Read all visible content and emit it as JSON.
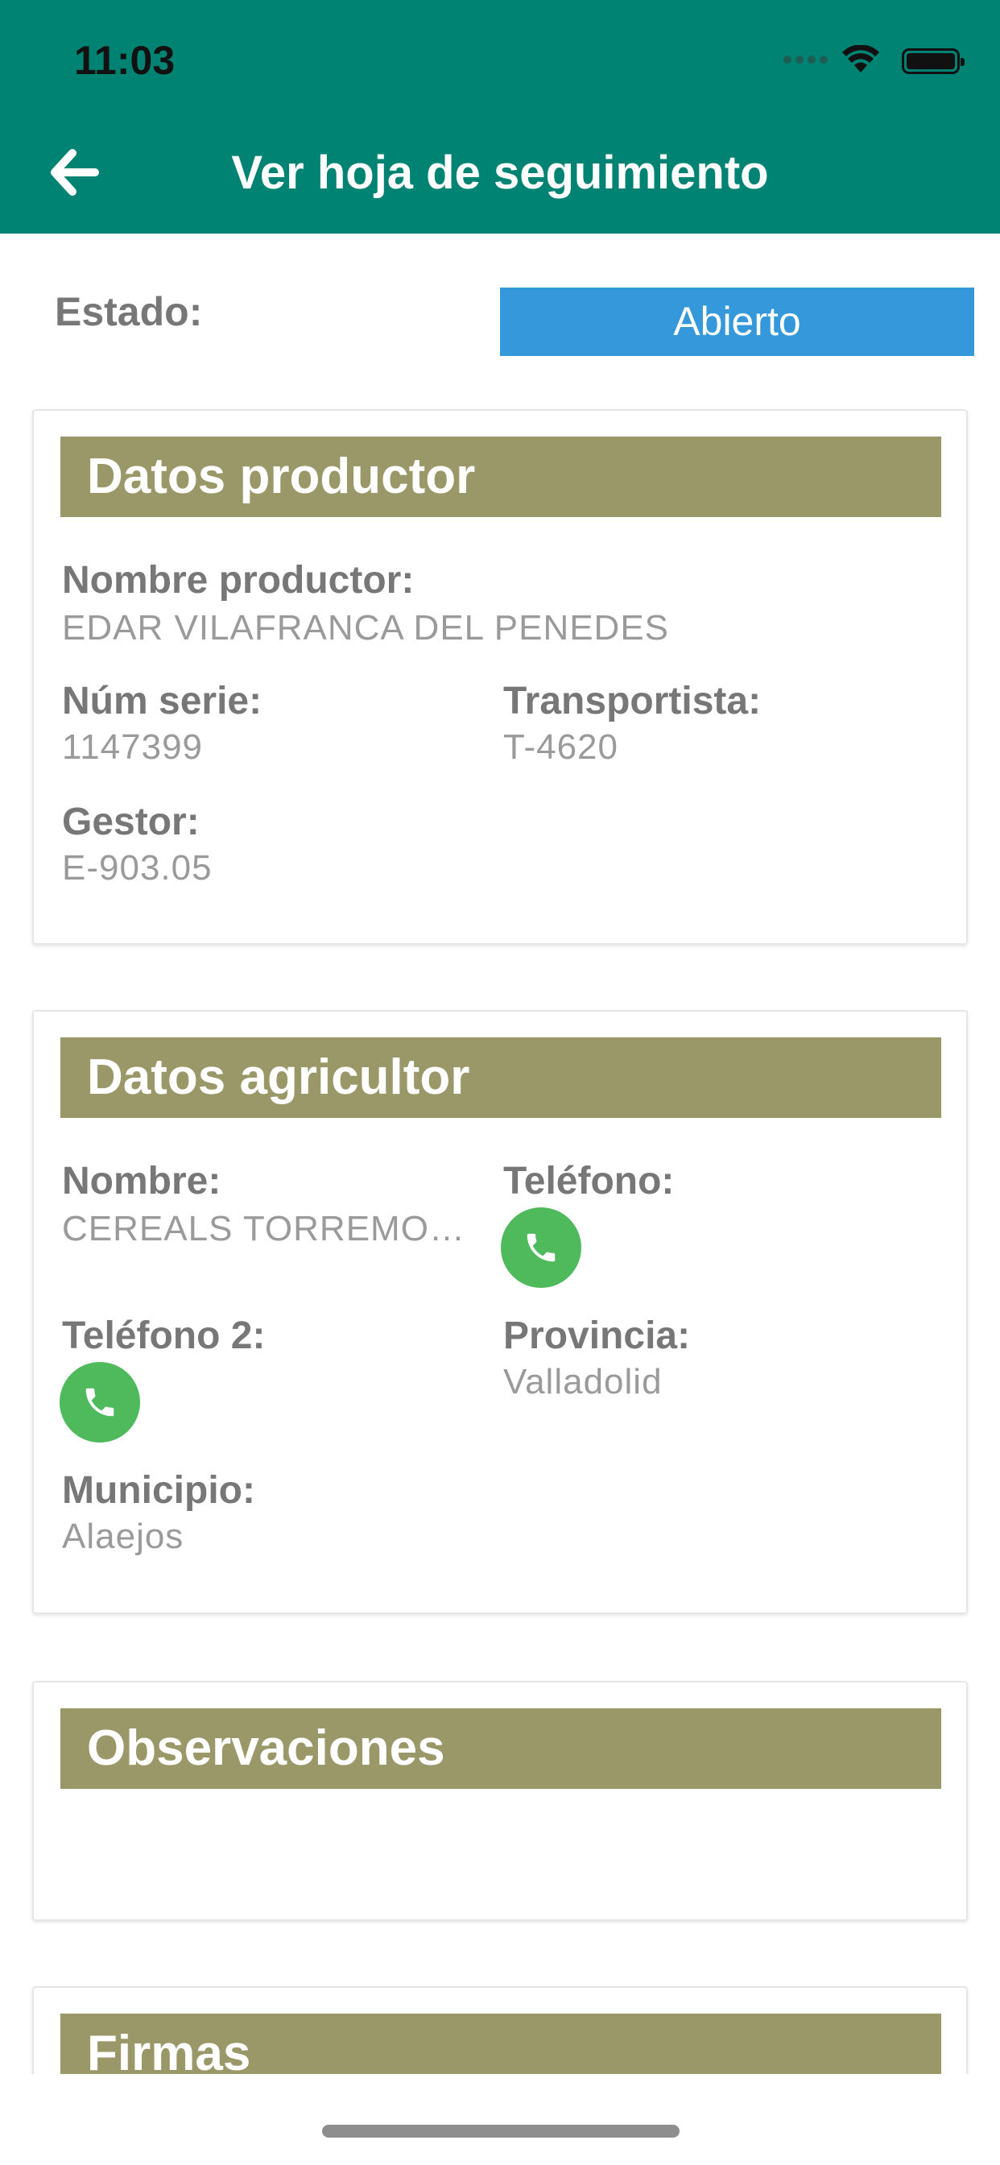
{
  "status_bar": {
    "time": "11:03"
  },
  "header": {
    "title": "Ver hoja de seguimiento"
  },
  "estado": {
    "label": "Estado:",
    "value": "Abierto"
  },
  "datos_productor": {
    "title": "Datos productor",
    "nombre_label": "Nombre productor:",
    "nombre_value": "EDAR VILAFRANCA DEL PENEDES",
    "serie_label": "Núm serie:",
    "serie_value": "1147399",
    "transportista_label": "Transportista:",
    "transportista_value": "T-4620",
    "gestor_label": "Gestor:",
    "gestor_value": "E-903.05"
  },
  "datos_agricultor": {
    "title": "Datos agricultor",
    "nombre_label": "Nombre:",
    "nombre_value": "CEREALS TORREMORELL",
    "telefono_label": "Teléfono:",
    "telefono2_label": "Teléfono 2:",
    "provincia_label": "Provincia:",
    "provincia_value": "Valladolid",
    "municipio_label": "Municipio:",
    "municipio_value": "Alaejos"
  },
  "observaciones": {
    "title": "Observaciones"
  },
  "firmas": {
    "title": "Firmas"
  },
  "colors": {
    "header_bg": "#008373",
    "status_badge": "#3498db",
    "section_header": "#9a9868",
    "phone_button": "#4fba5c"
  },
  "icons": {
    "back": "arrow-left-icon",
    "phone": "phone-icon",
    "wifi": "wifi-icon",
    "battery": "battery-icon"
  }
}
